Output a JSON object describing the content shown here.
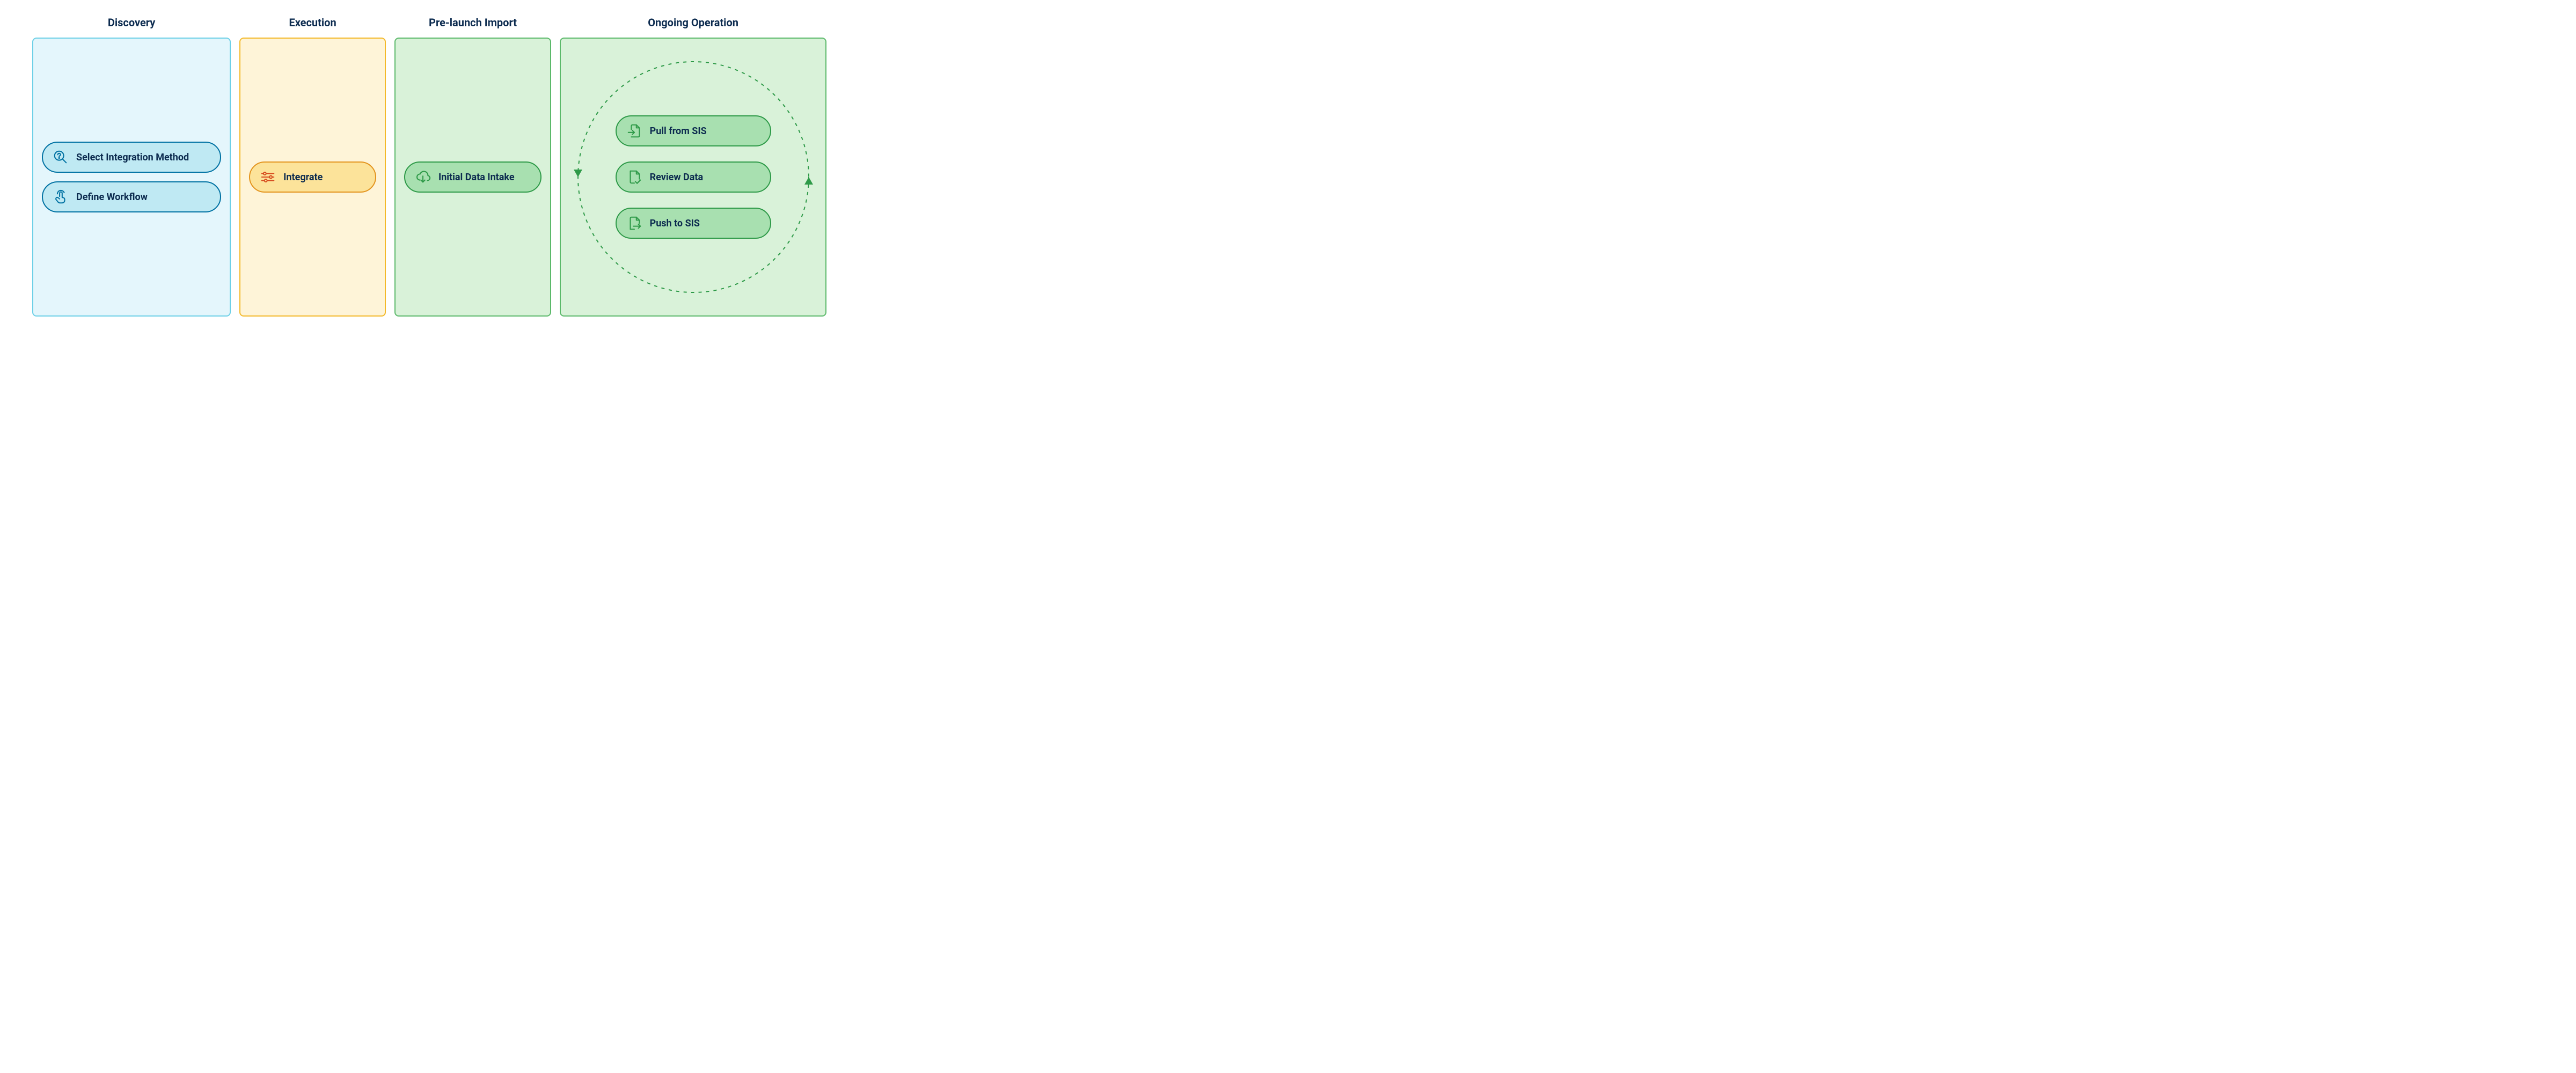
{
  "phases": {
    "discovery": {
      "title": "Discovery",
      "items": [
        {
          "label": "Select Integration Method"
        },
        {
          "label": "Define Workflow"
        }
      ]
    },
    "execution": {
      "title": "Execution",
      "items": [
        {
          "label": "Integrate"
        }
      ]
    },
    "prelaunch": {
      "title": "Pre-launch Import",
      "items": [
        {
          "label": "Initial Data Intake"
        }
      ]
    },
    "ongoing": {
      "title": "Ongoing Operation",
      "items": [
        {
          "label": "Pull from SIS"
        },
        {
          "label": "Review Data"
        },
        {
          "label": "Push to SIS"
        }
      ]
    }
  },
  "colors": {
    "blue_stroke": "#0072a3",
    "yellow_stroke": "#e3941e",
    "green_stroke": "#2e9a48",
    "arrow_green": "#2e9a48",
    "title_text": "#0c2b4f"
  }
}
